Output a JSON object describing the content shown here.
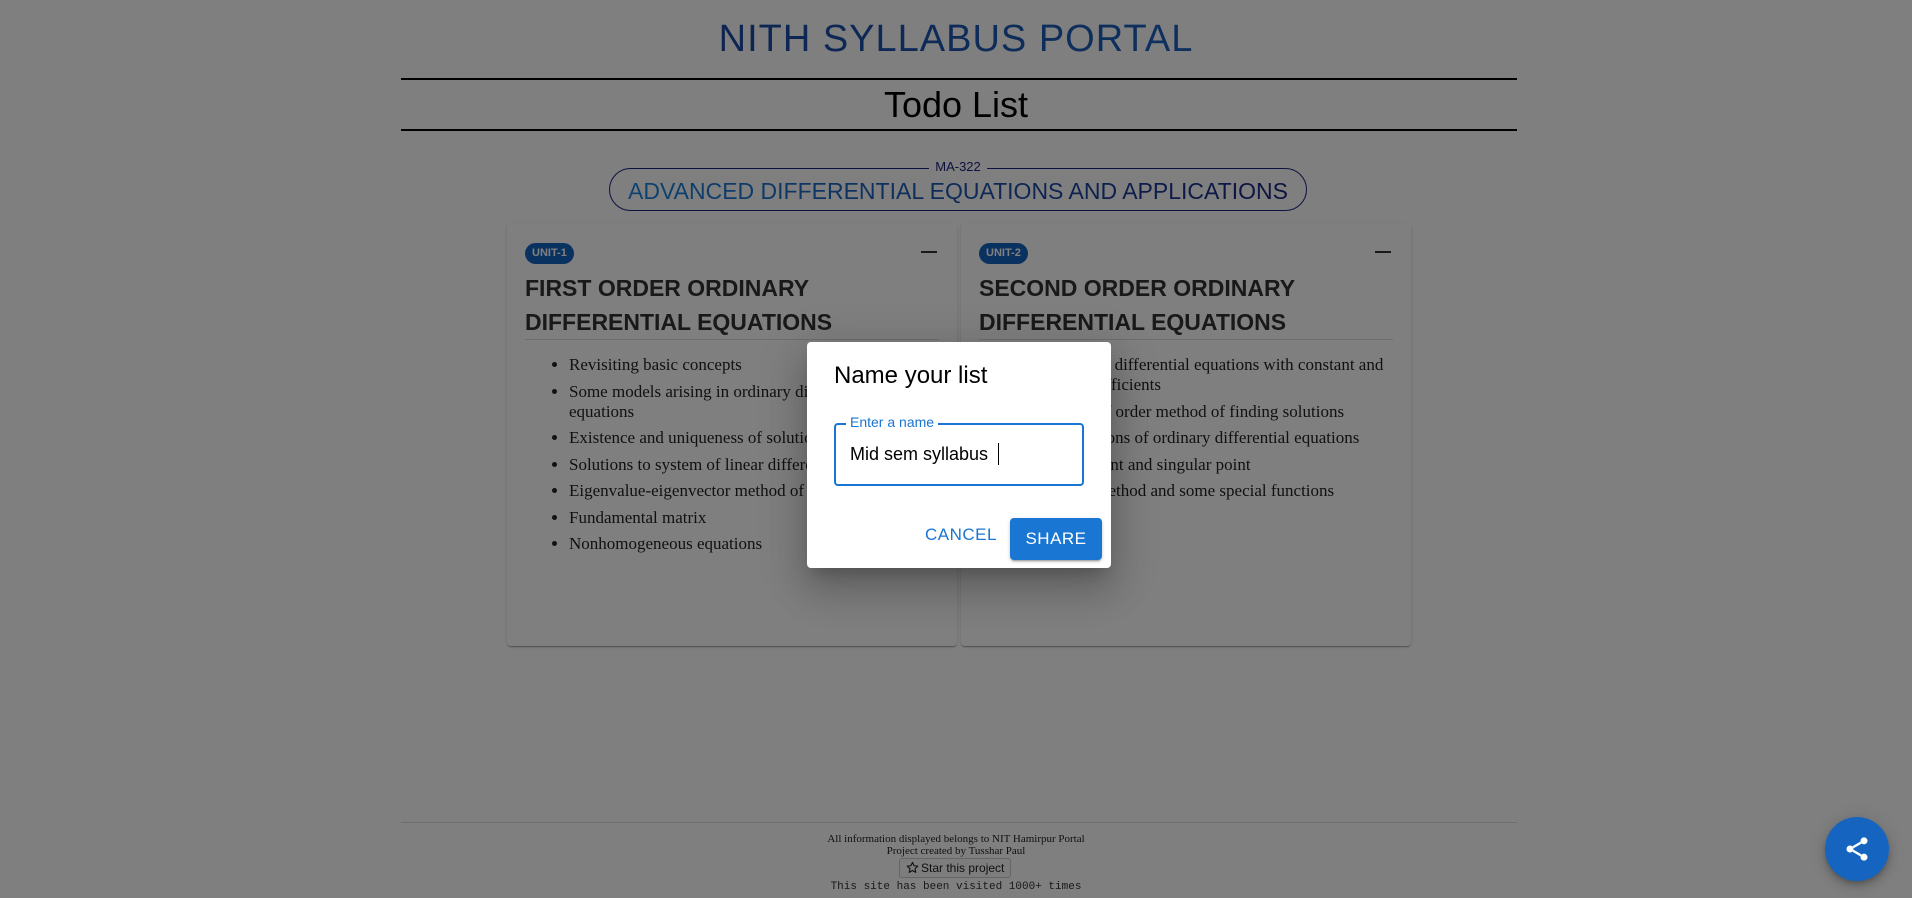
{
  "site": {
    "title": "NITH SYLLABUS PORTAL"
  },
  "page": {
    "heading": "Todo List"
  },
  "course": {
    "code": "MA-322",
    "name": "ADVANCED DIFFERENTIAL EQUATIONS AND APPLICATIONS"
  },
  "units": [
    {
      "badge": "UNIT-1",
      "title": "FIRST ORDER ORDINARY DIFFERENTIAL EQUATIONS",
      "topics": [
        "Revisiting basic concepts",
        "Some models arising in ordinary differential equations",
        "Existence and uniqueness of solutions Theorem",
        "Solutions to system of linear differential equations",
        "Eigenvalue-eigenvector method of finding solutions",
        "Fundamental matrix",
        "Nonhomogeneous equations"
      ]
    },
    {
      "badge": "UNIT-2",
      "title": "SECOND ORDER ORDINARY DIFFERENTIAL EQUATIONS",
      "topics": [
        "Higher order differential equations with constant and variable coefficients",
        "Reduction of order method of finding solutions",
        "Series solutions of ordinary differential equations",
        "Ordinary point and singular point",
        "Frobenius method and some special functions"
      ]
    }
  ],
  "dialog": {
    "title": "Name your list",
    "field_label": "Enter a name",
    "field_value": "Mid sem syllabus",
    "cancel_label": "CANCEL",
    "share_label": "SHARE"
  },
  "footer": {
    "line1": "All information displayed belongs to NIT Hamirpur Portal",
    "line2": "Project created by Tusshar Paul",
    "star_label": "Star this project",
    "visits": "This site has been visited 1000+ times"
  },
  "icons": {
    "collapse": "minus-icon",
    "star": "star-icon",
    "share": "share-icon"
  },
  "colors": {
    "primary": "#1976d2",
    "chip": "#1565c0",
    "title_dark": "#1a237e"
  }
}
